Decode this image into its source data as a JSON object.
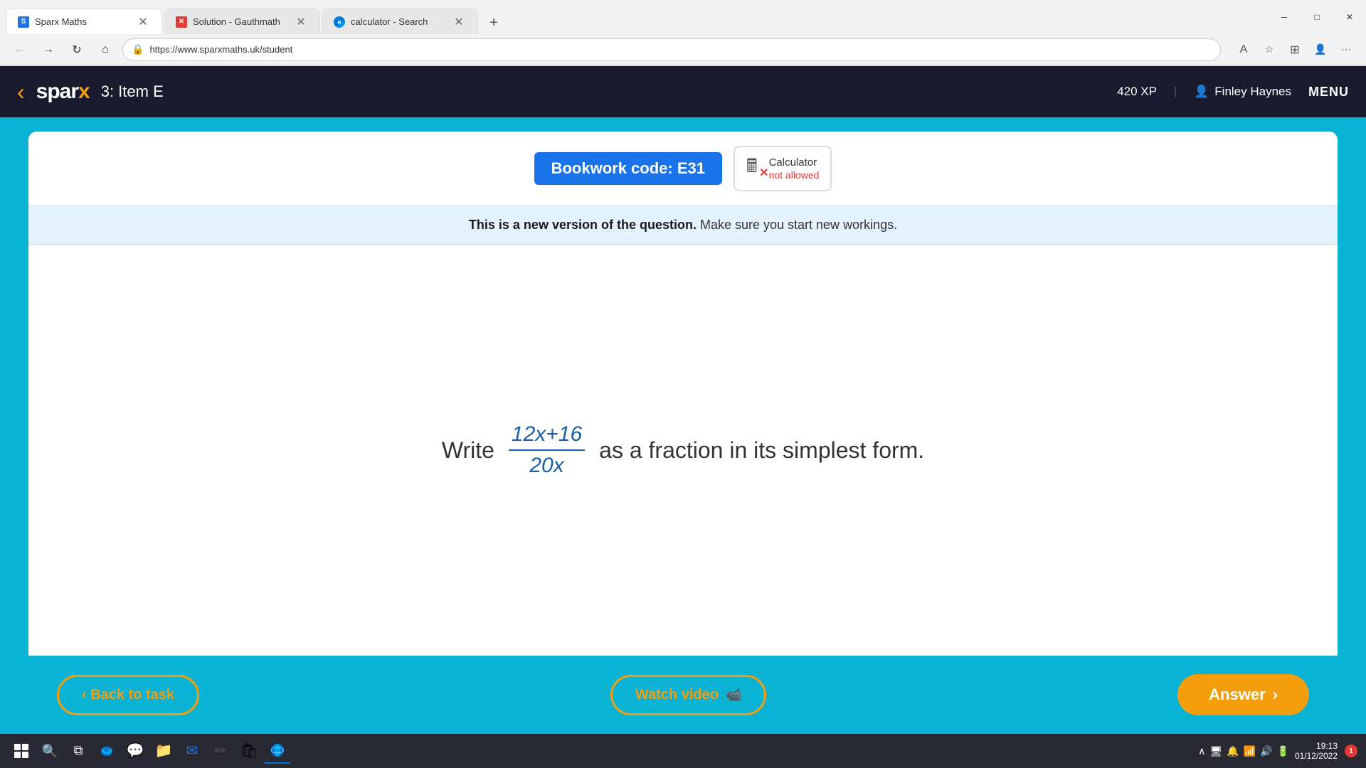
{
  "browser": {
    "tabs": [
      {
        "id": "sparx",
        "title": "Sparx Maths",
        "icon": "S",
        "icon_type": "sparx",
        "active": true
      },
      {
        "id": "gauthmath",
        "title": "Solution - Gauthmath",
        "icon": "G",
        "icon_type": "gauthmath",
        "active": false
      },
      {
        "id": "calculator",
        "title": "calculator - Search",
        "icon": "e",
        "icon_type": "edge",
        "active": false
      }
    ],
    "url": "https://www.sparxmaths.uk/student",
    "window_controls": [
      "─",
      "□",
      "✕"
    ]
  },
  "header": {
    "back_icon": "‹",
    "logo": "sparx",
    "item_label": "3: Item E",
    "xp": "420 XP",
    "user": "Finley Haynes",
    "menu": "MENU"
  },
  "bookwork": {
    "label": "Bookwork code: E31",
    "calculator_label": "Calculator",
    "calculator_not_allowed": "not allowed"
  },
  "new_version_banner": {
    "bold": "This is a new version of the question.",
    "rest": " Make sure you start new workings."
  },
  "question": {
    "prefix": "Write",
    "fraction_num": "12x+16",
    "fraction_den": "20x",
    "suffix": "as a fraction in its simplest form."
  },
  "buttons": {
    "back_task": "‹ Back to task",
    "watch_video": "Watch video 🎥",
    "answer": "Answer ›"
  },
  "taskbar": {
    "time": "19:13",
    "date": "01/12/2022",
    "notification_count": "1"
  }
}
